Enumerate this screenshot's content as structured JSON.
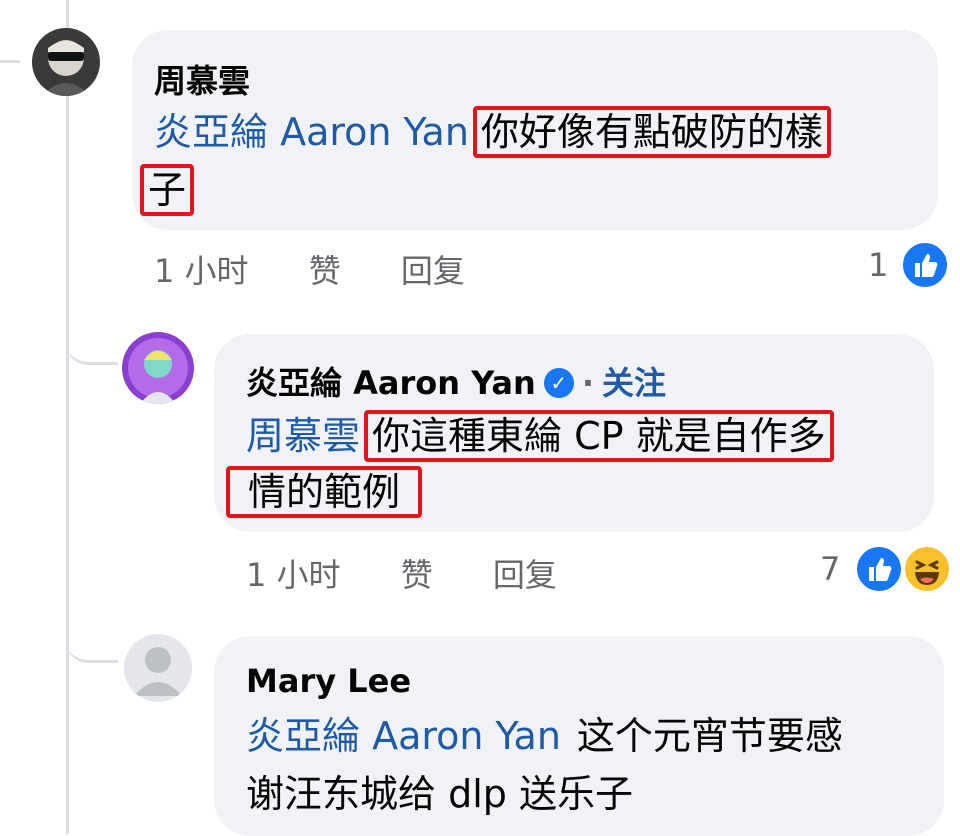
{
  "comments": [
    {
      "author": "周慕雲",
      "mention": "炎亞綸 Aaron Yan",
      "highlight_1": "你好像有點破防的樣",
      "highlight_2": "子",
      "time": "1 小时",
      "like_label": "赞",
      "reply_label": "回复",
      "reaction_count": "1",
      "reactions": [
        "like-icon"
      ]
    },
    {
      "author": "炎亞綸 Aaron Yan",
      "follow_label": "关注",
      "separator": "·",
      "mention": "周慕雲",
      "highlight_1": "你這種東綸 CP 就是自作多",
      "highlight_2": "情的範例",
      "time": "1 小时",
      "like_label": "赞",
      "reply_label": "回复",
      "reaction_count": "7",
      "reactions": [
        "like-icon",
        "haha-icon"
      ]
    },
    {
      "author": "Mary Lee",
      "mention": "炎亞綸 Aaron Yan",
      "text_1": "这个元宵节要感",
      "text_2": "谢汪东城给 dlp 送乐子"
    }
  ],
  "colors": {
    "bubble": "#f0f2f5",
    "mention": "#1f5aa6",
    "highlight_border": "#e1141c",
    "like": "#1877f2",
    "meta_text": "#65676b"
  }
}
